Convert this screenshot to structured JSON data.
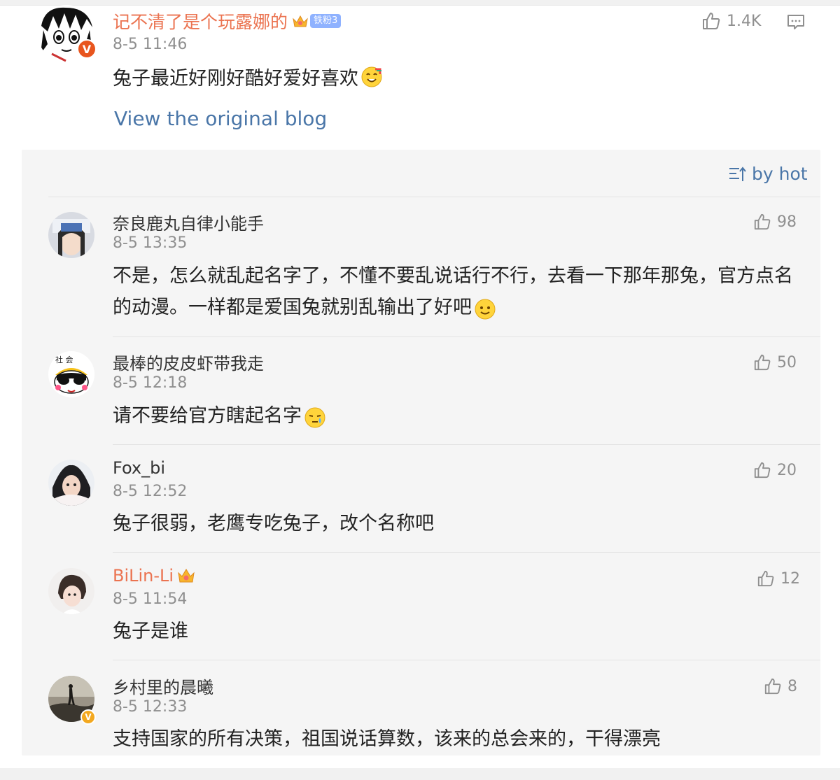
{
  "post": {
    "author": "记不清了是个玩露娜的",
    "fan_badge": "铁粉3",
    "time": "8-5 11:46",
    "text": "兔子最近好刚好酷好爱好喜欢",
    "like_count": "1.4K",
    "view_original": "View the original blog"
  },
  "sort": {
    "label": "by hot"
  },
  "comments": [
    {
      "name": "奈良鹿丸自律小能手",
      "time": "8-5 13:35",
      "text": "不是，怎么就乱起名字了，不懂不要乱说话行不行，去看一下那年那兔，官方点名的动漫。一样都是爱国兔就别乱输出了好吧",
      "likes": "98"
    },
    {
      "name": "最棒的皮皮虾带我走",
      "time": "8-5 12:18",
      "text": "请不要给官方瞎起名字",
      "likes": "50"
    },
    {
      "name": "Fox_bi",
      "time": "8-5 12:52",
      "text": "兔子很弱，老鹰专吃兔子，改个名称吧",
      "likes": "20"
    },
    {
      "name": "BiLin-Li",
      "time": "8-5 11:54",
      "text": "兔子是谁",
      "likes": "12"
    },
    {
      "name": "乡村里的晨曦",
      "time": "8-5 12:33",
      "text": "支持国家的所有决策，祖国说话算数，该来的总会来的，干得漂亮",
      "likes": "8"
    }
  ],
  "badges": {
    "verified": "V",
    "avatar_text": "社 会"
  },
  "colors": {
    "name_orange": "#eb7350",
    "link_blue": "#4a76a8",
    "meta_gray": "#8f8f8f",
    "panel_bg": "#f5f5f5"
  },
  "icons": [
    "thumbs-up-icon",
    "comment-icon",
    "sort-icon",
    "verified-badge-icon",
    "crown-icon",
    "emoji-icon"
  ]
}
